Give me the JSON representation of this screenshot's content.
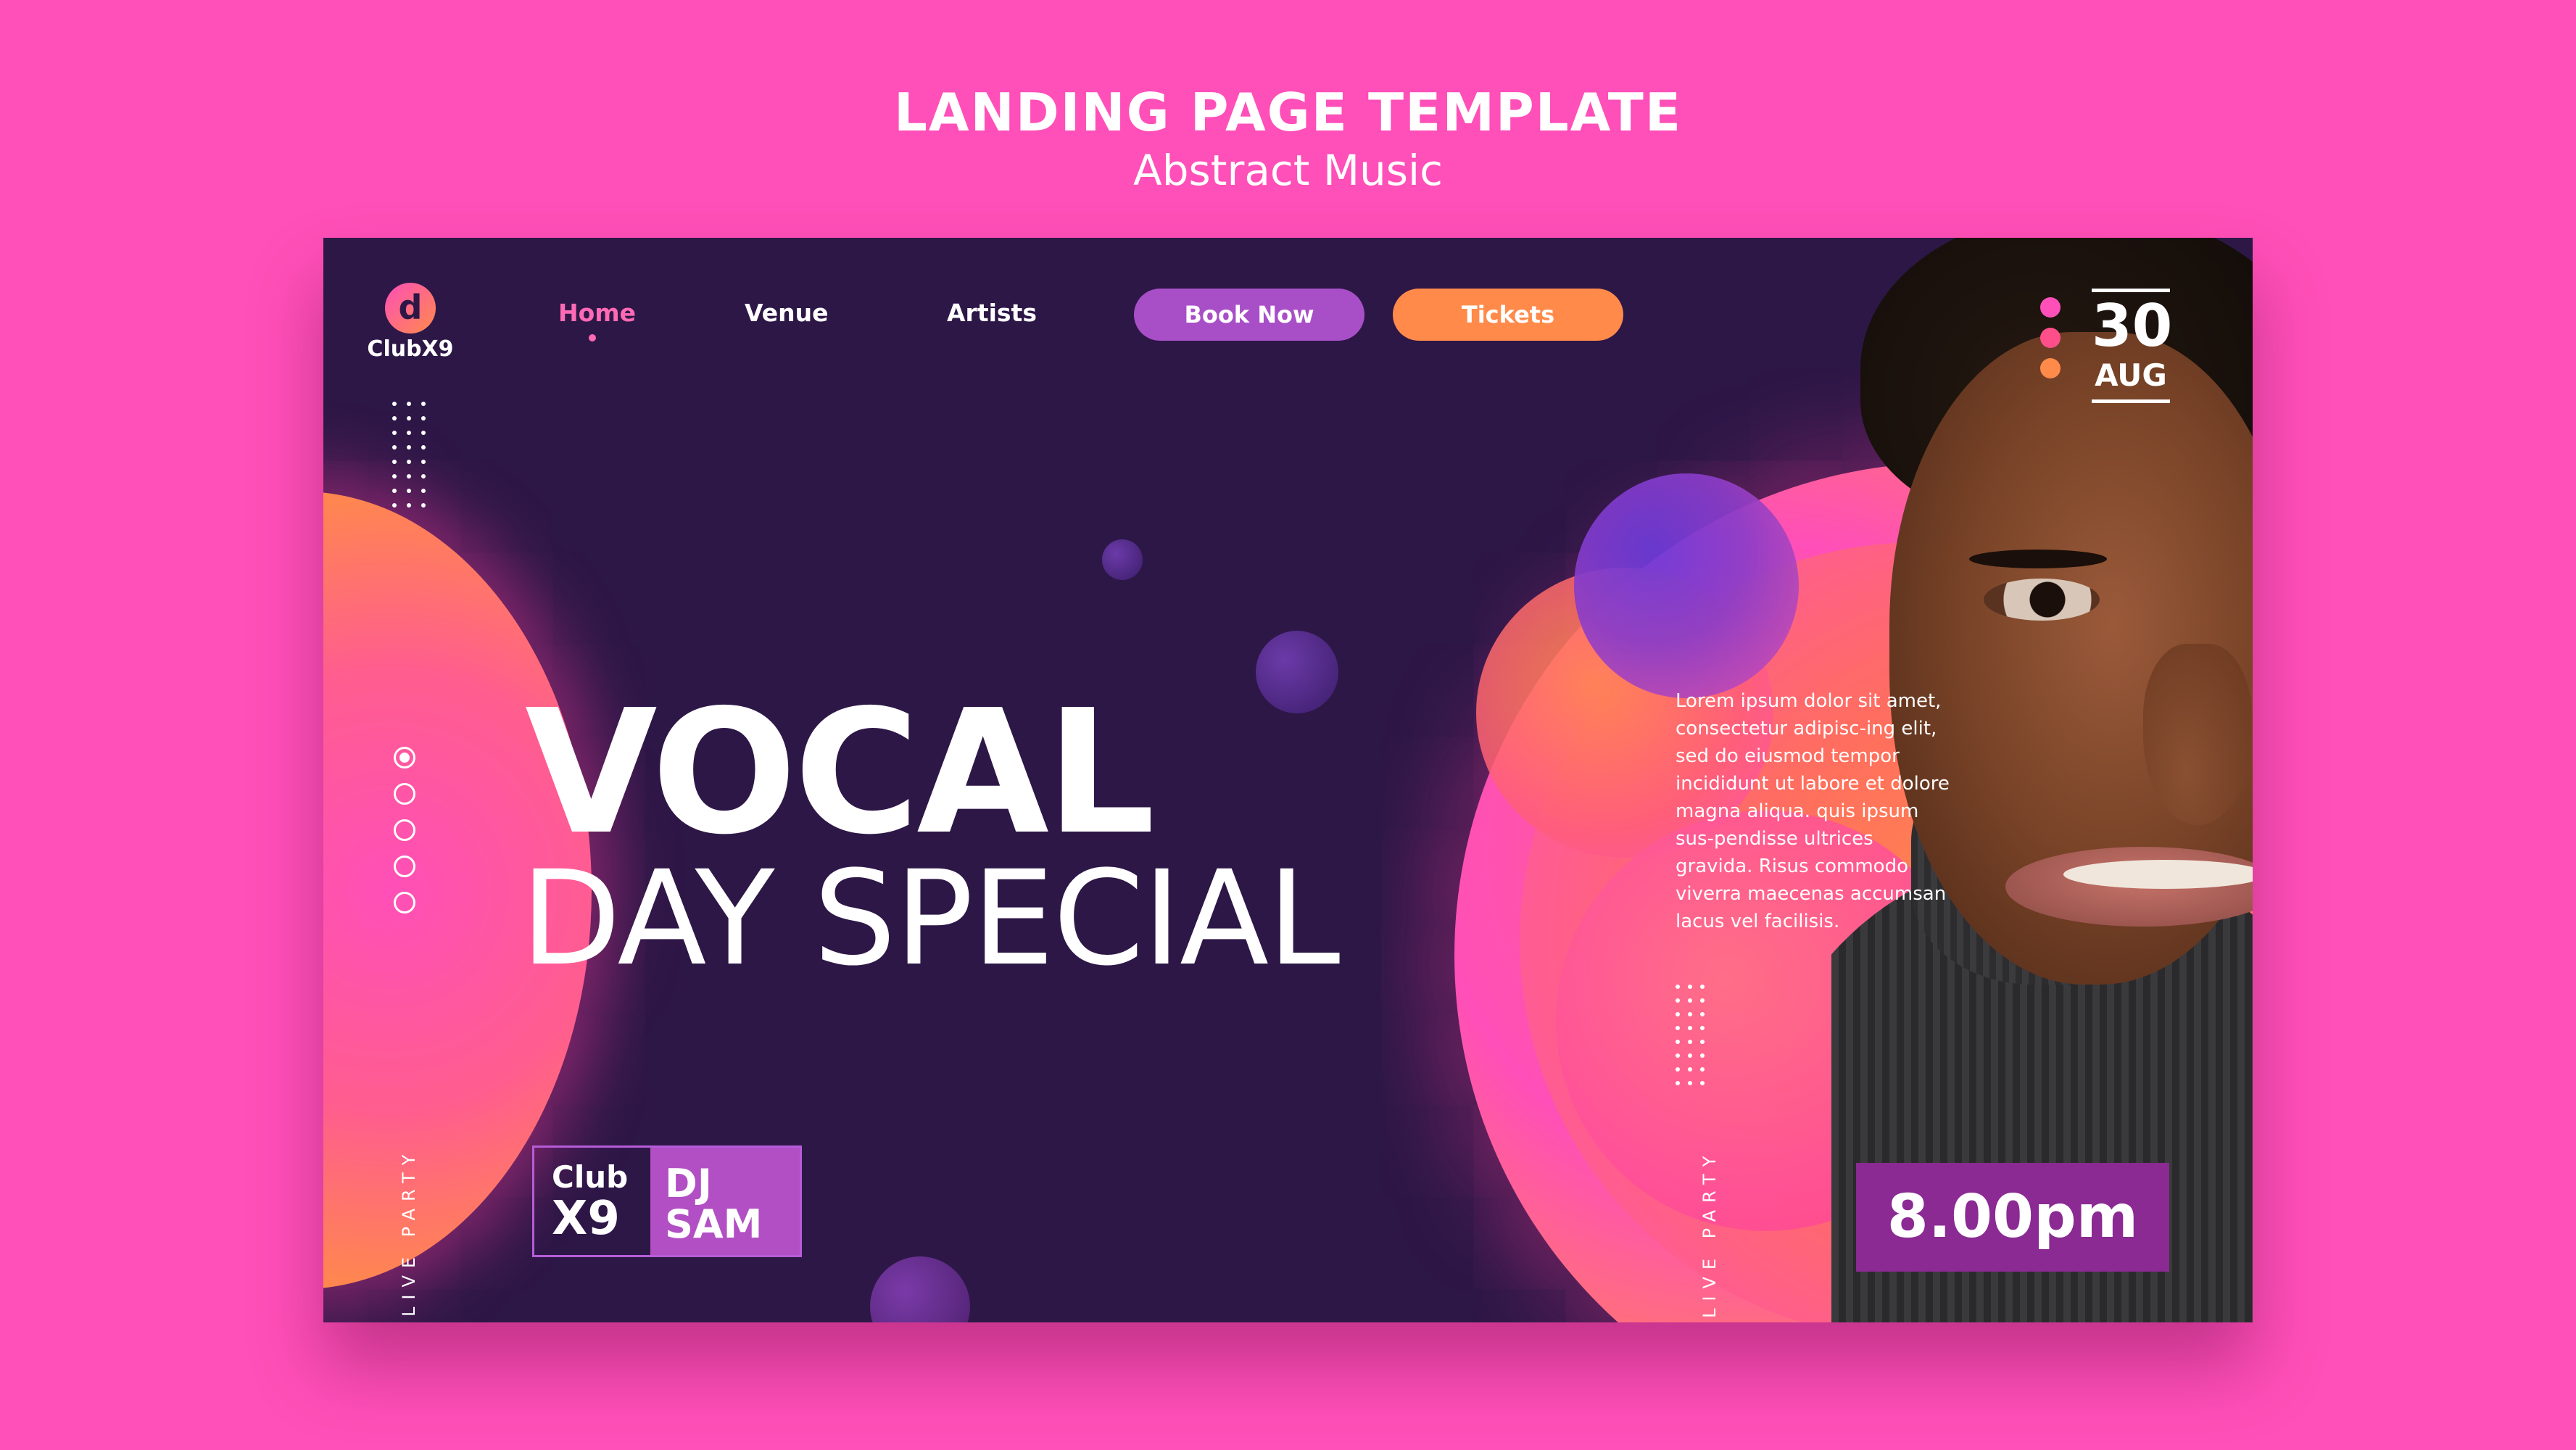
{
  "template": {
    "title": "LANDING PAGE TEMPLATE",
    "subtitle": "Abstract Music"
  },
  "brand": {
    "logo_glyph": "d",
    "name": "ClubX9"
  },
  "nav": {
    "items": [
      {
        "label": "Home",
        "active": true
      },
      {
        "label": "Venue",
        "active": false
      },
      {
        "label": "Artists",
        "active": false
      }
    ],
    "book_now": "Book Now",
    "tickets": "Tickets"
  },
  "hero": {
    "title": "VOCAL",
    "subtitle": "DAY SPECIAL"
  },
  "slider": {
    "total": 5,
    "active_index": 0
  },
  "side_text": {
    "left": "LIVE PARTY",
    "right": "LIVE PARTY"
  },
  "club_badge": {
    "line1": "Club",
    "line2": "X9",
    "dj_line1": "DJ",
    "dj_line2": "SAM"
  },
  "lorem": "Lorem ipsum dolor sit amet, consectetur adipisc-ing elit, sed do eiusmod tempor incididunt ut labore et dolore magna aliqua. quis ipsum sus-pendisse ultrices gravida. Risus commodo viverra maecenas accumsan lacus vel facilisis.",
  "event_date": {
    "day": "30",
    "month": "AUG"
  },
  "event_time": "8.00pm",
  "colors": {
    "page_bg": "#ff4fb8",
    "panel_bg": "#2d1747",
    "accent_pink": "#ff6ab5",
    "accent_purple": "#a84fc8",
    "accent_orange": "#ff8a4a",
    "time_bg": "#8a2a92"
  },
  "icons": {
    "logo": "music-disc-icon",
    "slider": "radio-dot-icon"
  }
}
